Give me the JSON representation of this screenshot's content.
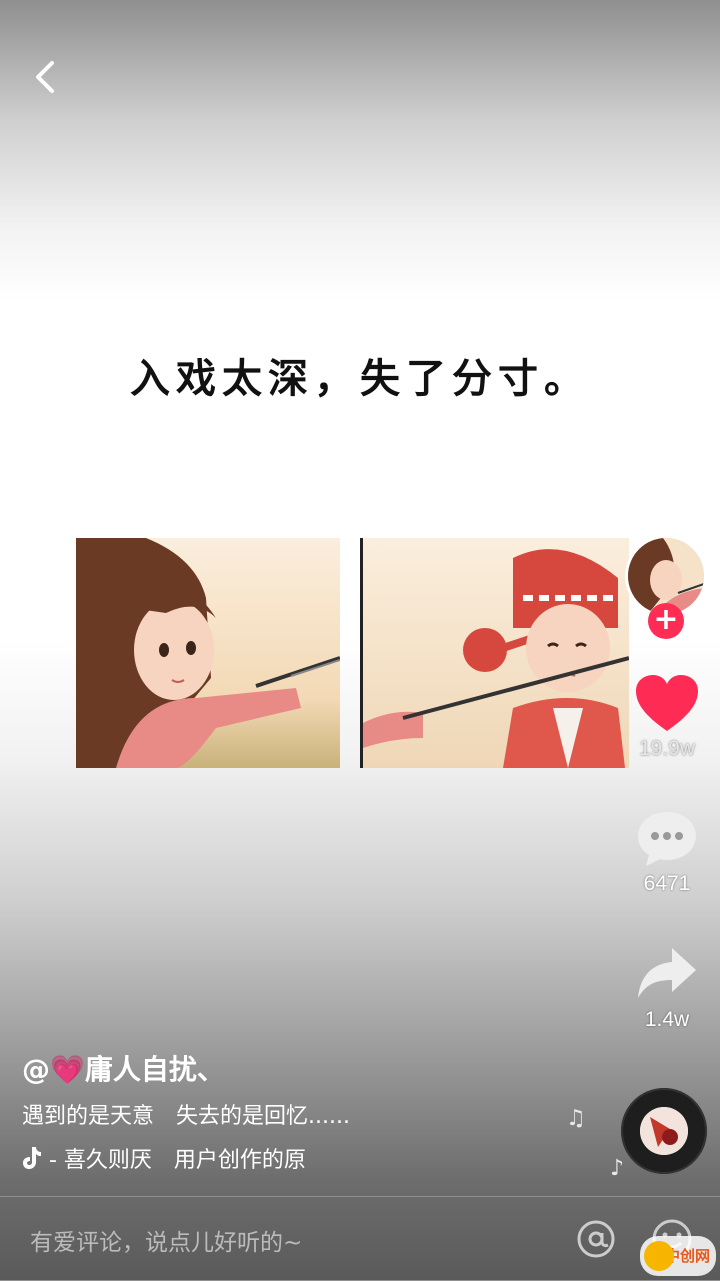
{
  "caption": "入戏太深，失了分寸。",
  "sidebar": {
    "follow_symbol": "+",
    "likes": "19.9w",
    "comments": "6471",
    "shares": "1.4w"
  },
  "post": {
    "username": "@💗庸人自扰、",
    "description": "遇到的是天意　失去的是回忆......",
    "music": " - 喜久则厌　用户创作的原"
  },
  "comment_bar": {
    "placeholder": "有爱评论，说点儿好听的~"
  },
  "watermark": "中创网",
  "icons": {
    "back": "chevron-left-icon",
    "heart": "heart-icon",
    "comment": "speech-bubble-icon",
    "share": "share-arrow-icon",
    "music": "tiktok-note-icon",
    "at": "at-icon",
    "emoji": "smiley-icon"
  },
  "colors": {
    "like": "#fe2c55",
    "follow": "#ff2d55"
  }
}
